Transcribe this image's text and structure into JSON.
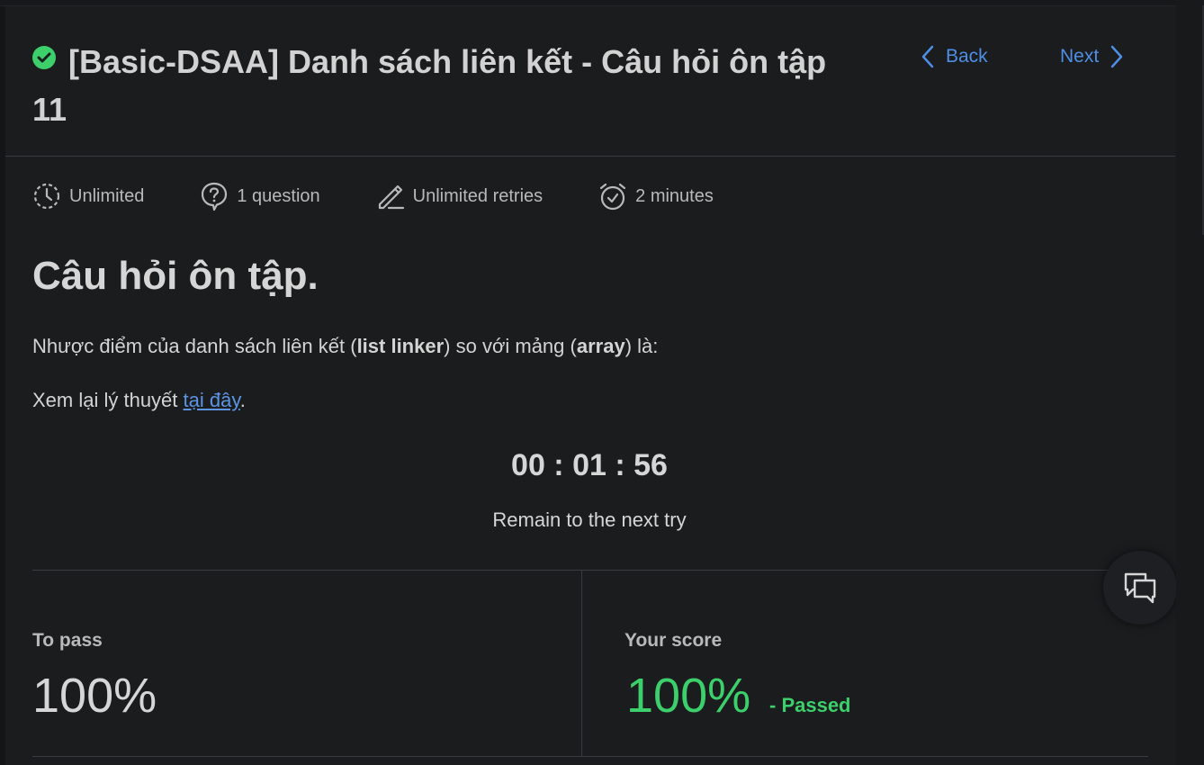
{
  "header": {
    "title": "[Basic-DSAA] Danh sách liên kết - Câu hỏi ôn tập 11",
    "back_label": "Back",
    "next_label": "Next"
  },
  "meta": {
    "time_limit": "Unlimited",
    "questions": "1 question",
    "retries": "Unlimited retries",
    "duration": "2 minutes"
  },
  "content": {
    "heading": "Câu hỏi ôn tập.",
    "question_prefix": "Nhược điểm của danh sách liên kết (",
    "question_bold1": "list linker",
    "question_middle": ") so với mảng (",
    "question_bold2": "array",
    "question_suffix": ") là:",
    "review_prefix": "Xem lại lý thuyết ",
    "review_link": "tại đây",
    "review_suffix": "."
  },
  "timer": {
    "value": "00 : 01 : 56",
    "caption": "Remain to the next try"
  },
  "results": {
    "to_pass_label": "To pass",
    "to_pass_value": "100%",
    "score_label": "Your score",
    "score_value": "100%",
    "status": "- Passed"
  },
  "colors": {
    "accent": "#4e8fe6",
    "success": "#3ccf6b",
    "background": "#1b1c1e"
  },
  "icons": {
    "status": "check-circle-icon",
    "back": "chevron-left-icon",
    "next": "chevron-right-icon",
    "time_limit": "clock-dashed-icon",
    "questions": "question-bubble-icon",
    "retries": "pencil-icon",
    "duration": "alarm-clock-icon",
    "chat": "chat-bubbles-icon"
  }
}
